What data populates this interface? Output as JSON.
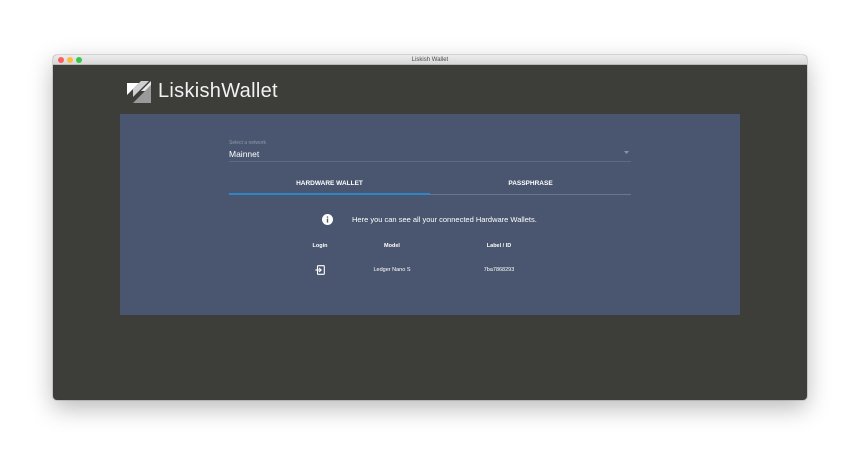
{
  "window": {
    "title": "Liskish Wallet"
  },
  "brand": {
    "name": "LiskishWallet"
  },
  "network": {
    "label": "Select a network",
    "value": "Mainnet"
  },
  "tabs": [
    {
      "label": "HARDWARE WALLET",
      "active": true
    },
    {
      "label": "PASSPHRASE",
      "active": false
    }
  ],
  "info": {
    "icon": "info-icon",
    "message": "Here you can see all your connected Hardware Wallets."
  },
  "table": {
    "headers": [
      "Login",
      "Model",
      "Label / ID"
    ],
    "rows": [
      {
        "login_icon": "login-icon",
        "model": "Ledger Nano S",
        "label_id": "7ba7868293"
      }
    ]
  },
  "colors": {
    "app_background": "#3d3d3a",
    "panel": "#4a566f",
    "tab_indicator": "#2f86c6"
  }
}
